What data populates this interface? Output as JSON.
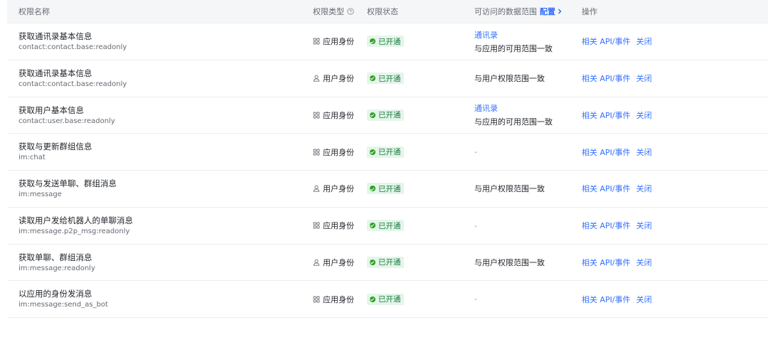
{
  "header": {
    "name": "权限名称",
    "type": "权限类型",
    "status": "权限状态",
    "scope": "可访问的数据范围",
    "config": "配置",
    "ops": "操作"
  },
  "rows": [
    {
      "name": "获取通讯录基本信息",
      "code": "contact:contact.base:readonly",
      "type": "应用身份",
      "type_icon": "grid-icon",
      "status": "已开通",
      "scope_link": "通讯录",
      "scope_text": "与应用的可用范围一致",
      "op_api": "相关 API/事件",
      "op_close": "关闭"
    },
    {
      "name": "获取通讯录基本信息",
      "code": "contact:contact.base:readonly",
      "type": "用户身份",
      "type_icon": "user-icon",
      "status": "已开通",
      "scope_link": "",
      "scope_text": "与用户权限范围一致",
      "op_api": "相关 API/事件",
      "op_close": "关闭"
    },
    {
      "name": "获取用户基本信息",
      "code": "contact:user.base:readonly",
      "type": "应用身份",
      "type_icon": "grid-icon",
      "status": "已开通",
      "scope_link": "通讯录",
      "scope_text": "与应用的可用范围一致",
      "op_api": "相关 API/事件",
      "op_close": "关闭"
    },
    {
      "name": "获取与更新群组信息",
      "code": "im:chat",
      "type": "应用身份",
      "type_icon": "grid-icon",
      "status": "已开通",
      "scope_link": "",
      "scope_text": "-",
      "op_api": "相关 API/事件",
      "op_close": "关闭"
    },
    {
      "name": "获取与发送单聊、群组消息",
      "code": "im:message",
      "type": "用户身份",
      "type_icon": "user-icon",
      "status": "已开通",
      "scope_link": "",
      "scope_text": "与用户权限范围一致",
      "op_api": "相关 API/事件",
      "op_close": "关闭"
    },
    {
      "name": "读取用户发给机器人的单聊消息",
      "code": "im:message.p2p_msg:readonly",
      "type": "应用身份",
      "type_icon": "grid-icon",
      "status": "已开通",
      "scope_link": "",
      "scope_text": "-",
      "op_api": "相关 API/事件",
      "op_close": "关闭"
    },
    {
      "name": "获取单聊、群组消息",
      "code": "im:message:readonly",
      "type": "用户身份",
      "type_icon": "user-icon",
      "status": "已开通",
      "scope_link": "",
      "scope_text": "与用户权限范围一致",
      "op_api": "相关 API/事件",
      "op_close": "关闭"
    },
    {
      "name": "以应用的身份发消息",
      "code": "im:message:send_as_bot",
      "type": "应用身份",
      "type_icon": "grid-icon",
      "status": "已开通",
      "scope_link": "",
      "scope_text": "-",
      "op_api": "相关 API/事件",
      "op_close": "关闭"
    }
  ],
  "colors": {
    "accent": "#3370ff",
    "status_bg": "#e4f5ea",
    "status_text": "#1b7d3f",
    "status_dot": "#2ea121"
  }
}
